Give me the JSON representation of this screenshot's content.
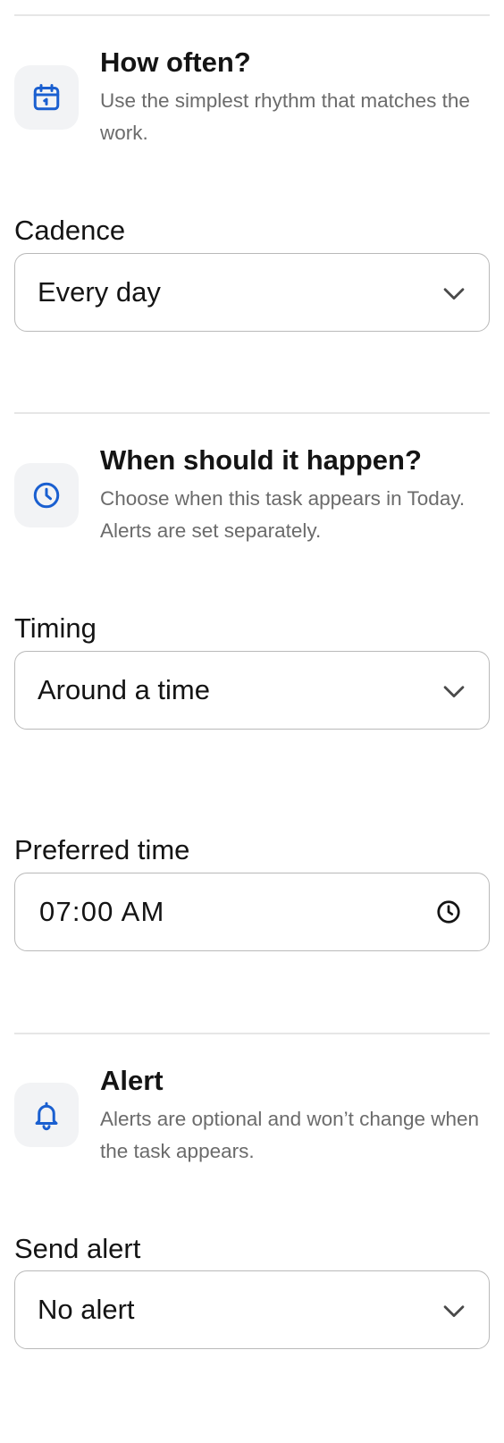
{
  "sections": {
    "frequency": {
      "title": "How often?",
      "description": "Use the simplest rhythm that matches the work.",
      "icon": "calendar-icon",
      "field_label": "Cadence",
      "select_value": "Every day"
    },
    "timing": {
      "title": "When should it happen?",
      "description": "Choose when this task appears in Today. Alerts are set separately.",
      "icon": "clock-icon",
      "field_label": "Timing",
      "select_value": "Around a time",
      "time_label": "Preferred time",
      "time_value": "07:00 AM"
    },
    "alert": {
      "title": "Alert",
      "description": "Alerts are optional and won’t change when the task appears.",
      "icon": "bell-icon",
      "field_label": "Send alert",
      "select_value": "No alert"
    }
  },
  "colors": {
    "accent": "#1a5fd0",
    "icon_tile": "#f2f3f5",
    "divider": "#e6e6e6",
    "field_border": "#b9b9b9",
    "secondary_text": "#6b6b6b"
  }
}
